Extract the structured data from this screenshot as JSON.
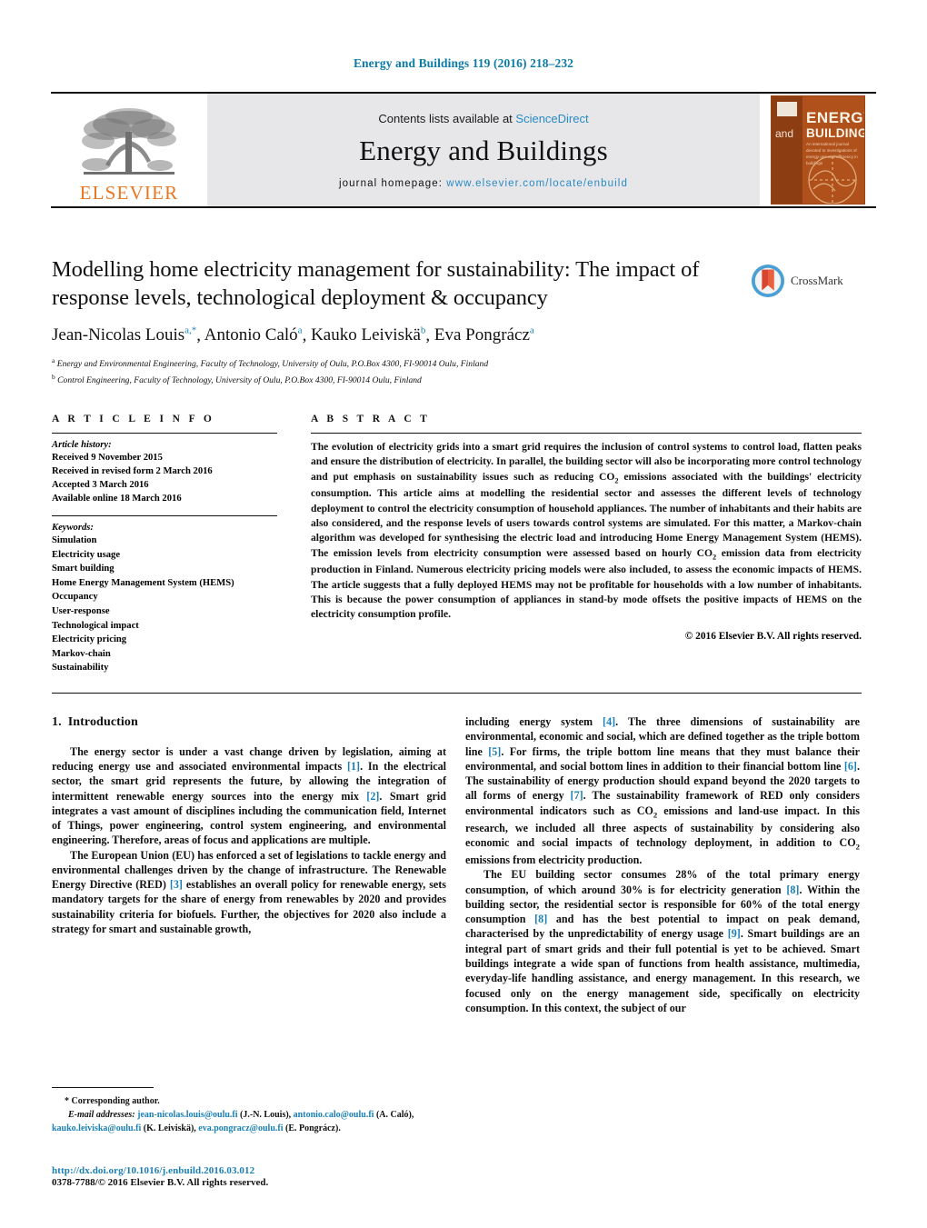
{
  "running_head": "Energy and Buildings 119 (2016) 218–232",
  "masthead": {
    "publisher_name": "ELSEVIER",
    "contents_prefix": "Contents lists available at ",
    "contents_link": "ScienceDirect",
    "journal_title": "Energy and Buildings",
    "homepage_prefix": "journal homepage: ",
    "homepage_url": "www.elsevier.com/locate/enbuild",
    "cover": {
      "and": "and",
      "energy": "ENERGY",
      "buildings": "BUILDINGS",
      "subtitle": "An international journal devoted to investigations of energy use and efficiency in buildings"
    }
  },
  "crossmark": {
    "label": "CrossMark"
  },
  "article": {
    "title": "Modelling home electricity management for sustainability: The impact of response levels, technological deployment & occupancy",
    "authors_html": "Jean-Nicolas Louis, Antonio Caló, Kauko Leiviskä, Eva Pongrácz",
    "affiliation_a": "Energy and Environmental Engineering, Faculty of Technology, University of Oulu, P.O.Box 4300, FI-90014 Oulu, Finland",
    "affiliation_b": "Control Engineering, Faculty of Technology, University of Oulu, P.O.Box 4300, FI-90014 Oulu, Finland"
  },
  "info": {
    "heading": "A R T I C L E   I N F O",
    "history_label": "Article history:",
    "history": [
      "Received 9 November 2015",
      "Received in revised form 2 March 2016",
      "Accepted 3 March 2016",
      "Available online 18 March 2016"
    ],
    "keywords_label": "Keywords:",
    "keywords": [
      "Simulation",
      "Electricity usage",
      "Smart building",
      "Home Energy Management System (HEMS)",
      "Occupancy",
      "User-response",
      "Technological impact",
      "Electricity pricing",
      "Markov-chain",
      "Sustainability"
    ]
  },
  "abstract": {
    "heading": "A B S T R A C T",
    "text": "The evolution of electricity grids into a smart grid requires the inclusion of control systems to control load, flatten peaks and ensure the distribution of electricity. In parallel, the building sector will also be incorporating more control technology and put emphasis on sustainability issues such as reducing CO2 emissions associated with the buildings' electricity consumption. This article aims at modelling the residential sector and assesses the different levels of technology deployment to control the electricity consumption of household appliances. The number of inhabitants and their habits are also considered, and the response levels of users towards control systems are simulated. For this matter, a Markov-chain algorithm was developed for synthesising the electric load and introducing Home Energy Management System (HEMS). The emission levels from electricity consumption were assessed based on hourly CO2 emission data from electricity production in Finland. Numerous electricity pricing models were also included, to assess the economic impacts of HEMS. The article suggests that a fully deployed HEMS may not be profitable for households with a low number of inhabitants. This is because the power consumption of appliances in stand-by mode offsets the positive impacts of HEMS on the electricity consumption profile.",
    "copyright": "© 2016 Elsevier B.V. All rights reserved."
  },
  "body": {
    "section_number": "1.",
    "section_title": "Introduction",
    "left_paragraphs": [
      "The energy sector is under a vast change driven by legislation, aiming at reducing energy use and associated environmental impacts [1]. In the electrical sector, the smart grid represents the future, by allowing the integration of intermittent renewable energy sources into the energy mix [2]. Smart grid integrates a vast amount of disciplines including the communication field, Internet of Things, power engineering, control system engineering, and environmental engineering. Therefore, areas of focus and applications are multiple.",
      "The European Union (EU) has enforced a set of legislations to tackle energy and environmental challenges driven by the change of infrastructure. The Renewable Energy Directive (RED) [3] establishes an overall policy for renewable energy, sets mandatory targets for the share of energy from renewables by 2020 and provides sustainability criteria for biofuels. Further, the objectives for 2020 also include a strategy for smart and sustainable growth,"
    ],
    "right_paragraphs": [
      "including energy system [4]. The three dimensions of sustainability are environmental, economic and social, which are defined together as the triple bottom line [5]. For firms, the triple bottom line means that they must balance their environmental, and social bottom lines in addition to their financial bottom line [6]. The sustainability of energy production should expand beyond the 2020 targets to all forms of energy [7]. The sustainability framework of RED only considers environmental indicators such as CO2 emissions and land-use impact. In this research, we included all three aspects of sustainability by considering also economic and social impacts of technology deployment, in addition to CO2 emissions from electricity production.",
      "The EU building sector consumes 28% of the total primary energy consumption, of which around 30% is for electricity generation [8]. Within the building sector, the residential sector is responsible for 60% of the total energy consumption [8] and has the best potential to impact on peak demand, characterised by the unpredictability of energy usage [9]. Smart buildings are an integral part of smart grids and their full potential is yet to be achieved. Smart buildings integrate a wide span of functions from health assistance, multimedia, everyday-life handling assistance, and energy management. In this research, we focused only on the energy management side, specifically on electricity consumption. In this context, the subject of our"
    ]
  },
  "footnote": {
    "corresponding": "* Corresponding author.",
    "email_label": "E-mail addresses:",
    "emails": [
      {
        "address": "jean-nicolas.louis@oulu.fi",
        "name": "(J.-N. Louis),"
      },
      {
        "address": "antonio.calo@oulu.fi",
        "name": "(A. Caló),"
      },
      {
        "address": "kauko.leiviska@oulu.fi",
        "name": "(K. Leiviskä),"
      },
      {
        "address": "eva.pongracz@oulu.fi",
        "name": "(E. Pongrácz)."
      }
    ]
  },
  "doi_block": {
    "doi": "http://dx.doi.org/10.1016/j.enbuild.2016.03.012",
    "issn": "0378-7788/© 2016 Elsevier B.V. All rights reserved."
  },
  "colors": {
    "link": "#1a7fb5",
    "sciencedirect": "#2a8bc4",
    "elsevier_orange": "#E87722",
    "cover_orange": "#b0511c"
  }
}
